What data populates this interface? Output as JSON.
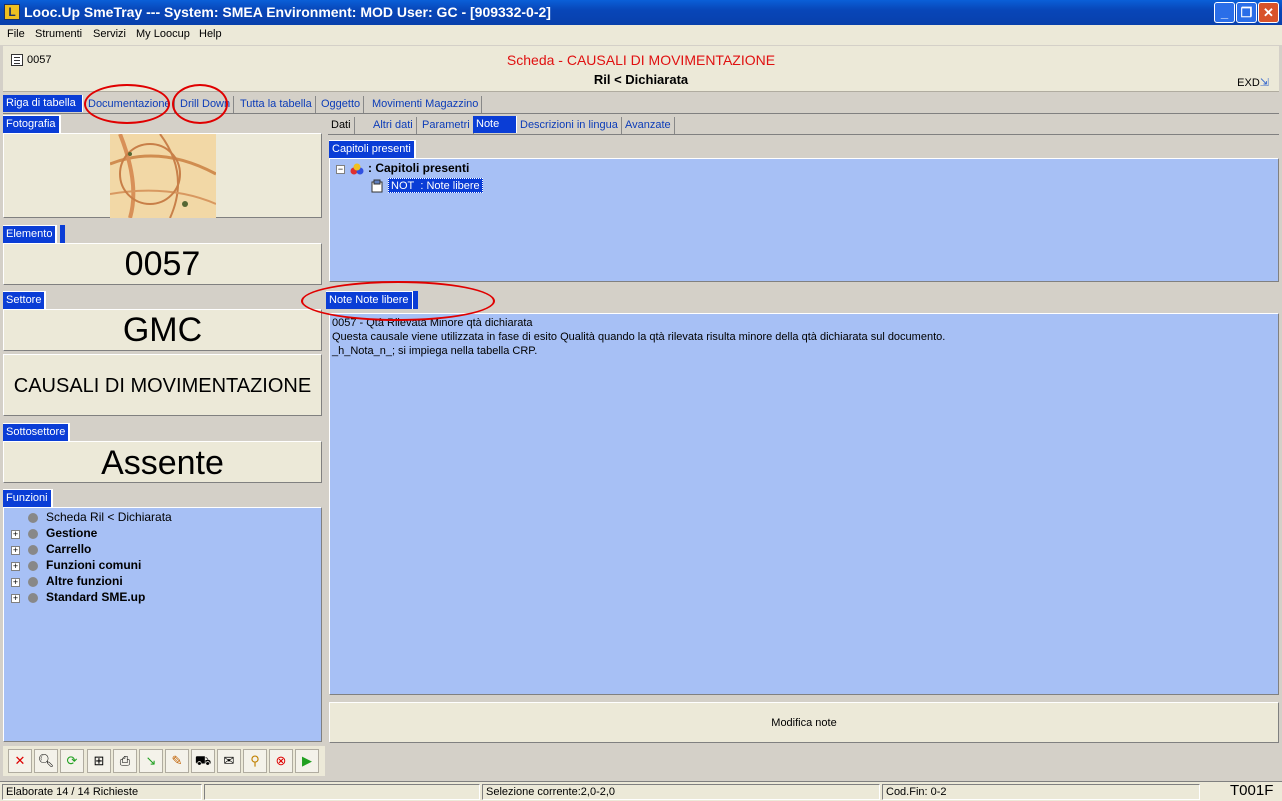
{
  "window": {
    "title": "Looc.Up SmeTray --- System: SMEA Environment: MOD User: GC - [909332-0-2]",
    "app_icon": "L"
  },
  "menu": [
    "File",
    "Strumenti",
    "Servizi",
    "My Loocup",
    "Help"
  ],
  "header": {
    "code": "0057",
    "title": "Scheda - CAUSALI DI MOVIMENTAZIONE",
    "subtitle": "Ril < Dichiarata",
    "exd": "EXD"
  },
  "main_tabs": [
    "Riga di tabella",
    "Documentazione",
    "Drill Down",
    "Tutta la tabella",
    "Oggetto",
    "Movimenti Magazzino"
  ],
  "left": {
    "foto_label": "Fotografia",
    "elemento_label": "Elemento",
    "elemento_value": "0057",
    "settore_label": "Settore",
    "settore_value": "GMC",
    "settore_desc": "CAUSALI DI MOVIMENTAZIONE",
    "sottosettore_label": "Sottosettore",
    "sottosettore_value": "Assente",
    "funzioni_label": "Funzioni",
    "funzioni": [
      "Scheda Ril < Dichiarata",
      "Gestione",
      "Carrello",
      "Funzioni comuni",
      "Altre funzioni",
      "Standard SME.up"
    ]
  },
  "sub_tabs": [
    "Dati",
    "Altri dati",
    "Parametri",
    "Note",
    "Descrizioni in lingua",
    "Avanzate"
  ],
  "capitoli": {
    "label": "Capitoli presenti",
    "root": ": Capitoli presenti",
    "code": "NOT",
    "child": ": Note libere"
  },
  "note": {
    "label": "Note Note libere",
    "lines": [
      "0057 - Qtà Rilevata Minore qtà dichiarata",
      "Questa causale viene utilizzata in fase di esito Qualità quando la qtà rilevata risulta minore della qtà dichiarata sul documento.",
      "_h_Nota_n_; si impiega nella tabella CRP."
    ],
    "button": "Modifica note"
  },
  "toolbar_icons": [
    "delete-icon",
    "search-icon",
    "refresh-icon",
    "tree-icon",
    "print-icon",
    "arrow-icon",
    "edit-icon",
    "cart-icon",
    "mail-icon",
    "zoom-icon",
    "stop-icon",
    "play-icon"
  ],
  "status": {
    "elaborate": "Elaborate 14 / 14 Richieste",
    "selezione": "Selezione corrente:2,0-2,0",
    "codfin": "Cod.Fin: 0-2",
    "code": "T001F"
  }
}
